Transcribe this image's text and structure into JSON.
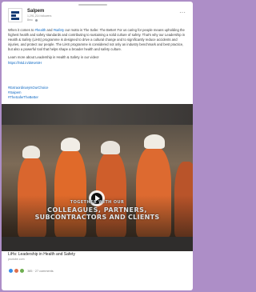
{
  "post": {
    "company_name": "Salpem",
    "followers": "1,291,214 followers",
    "post_age": "8mo",
    "body_paragraph_1_a": "When it comes to ",
    "tag_health": "#health",
    "body_paragraph_1_b": " and ",
    "tag_safety": "#safety",
    "body_paragraph_1_c": " our motto is The Safer. The Better! For us caring for people means upholding the highest health and safety standards and contributing to sustaining a solid culture of safety. That's why our Leadership in Health & Safety (LiHS) programme is designed to drive a cultural change and to significantly reduce accidents and injuries, and protect our people. The LiHS programme is considered not only an industry benchmark and best practice, but also a powerful tool that helps shape a broader health and safety culture.",
    "body_paragraph_2": "Learn more about Leadership in Health & Safety in our video!",
    "video_link": "https://lnkd.in/dsKe5tH",
    "hashtags": [
      "#ExtraordinaryIsOurChoice",
      "#Saipem",
      "#TheSaferTheBetter"
    ]
  },
  "video": {
    "caption_line_1": "TOGETHER WITH OUR",
    "caption_line_2": "COLLEAGUES, PARTNERS,",
    "caption_line_3": "SUBCONTRACTORS AND CLIENTS",
    "title": "LiHs: Leadership in Health and Safety",
    "source": "youtube.com"
  },
  "reactions": {
    "counts": "385 · 27 comments",
    "colors": [
      "#378fe9",
      "#df704d",
      "#6dae4f"
    ]
  }
}
